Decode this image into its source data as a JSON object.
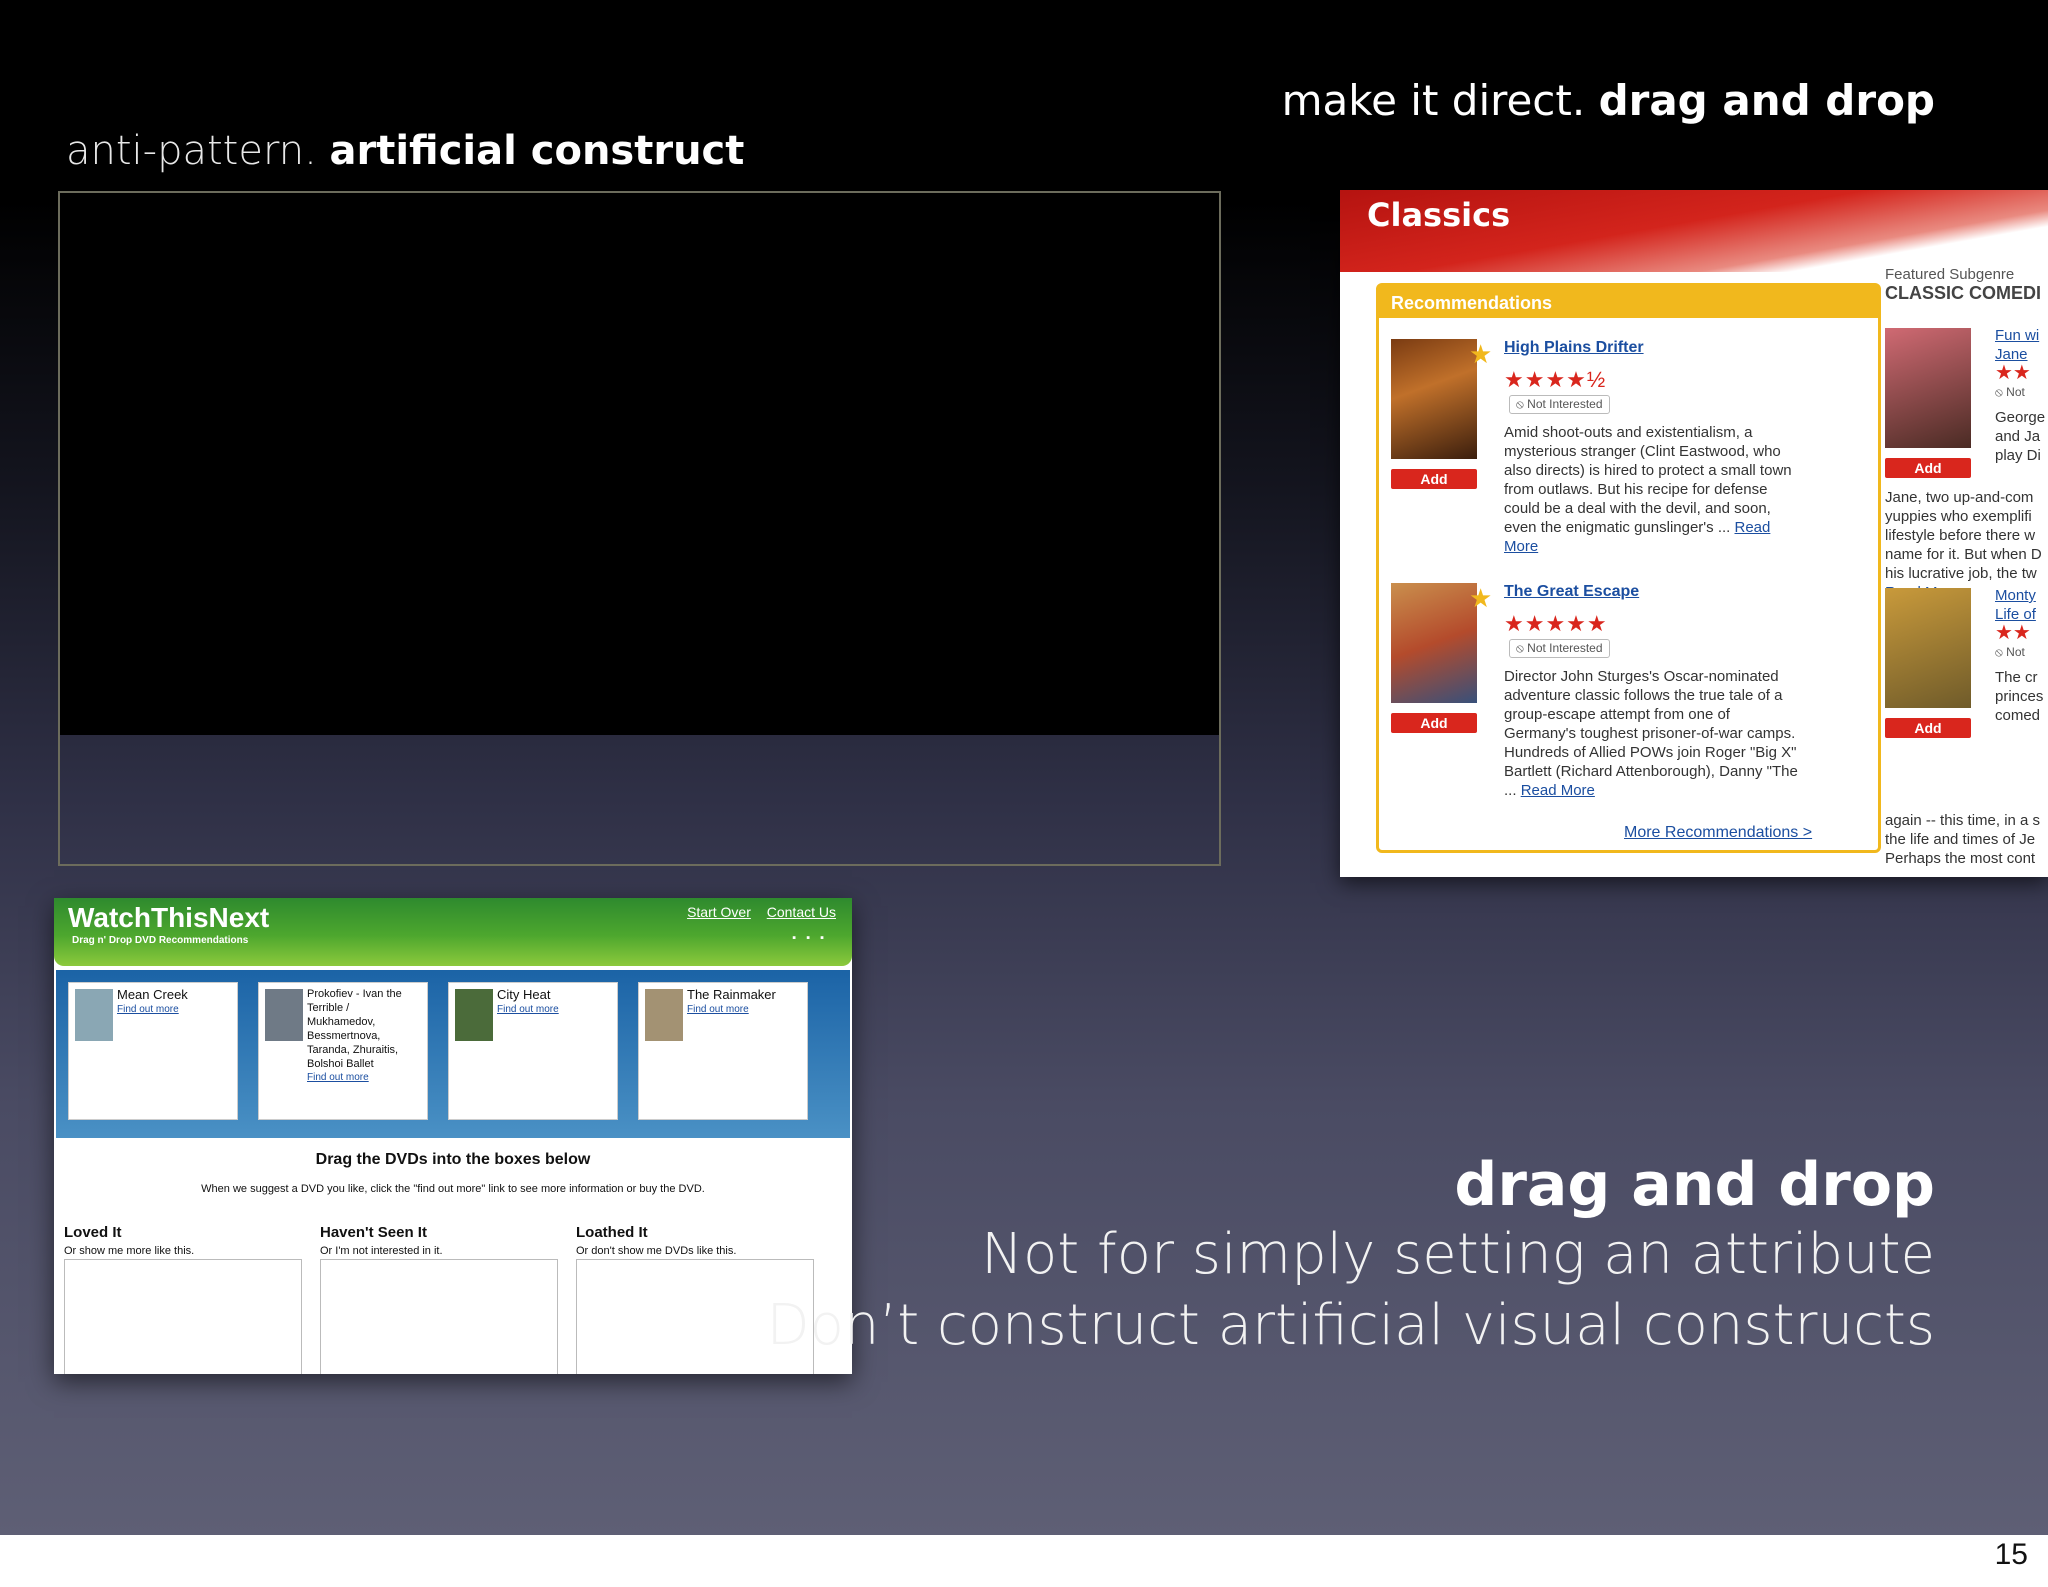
{
  "slide": {
    "title_left_light": "anti-pattern.",
    "title_left_bold": "artificial construct",
    "title_right_light": "make it direct.",
    "title_right_bold": "drag and drop",
    "heading": "drag and drop",
    "line1": "Not for simply setting an attribute",
    "line2": "Don’t construct artificial visual constructs",
    "page_number": "15"
  },
  "classics": {
    "title": "Classics",
    "rec_heading": "Recommendations",
    "items": [
      {
        "title": "High Plains Drifter",
        "rating": "★★★★½",
        "not_interested": "⦸ Not Interested",
        "add": "Add",
        "desc": "Amid shoot-outs and existentialism, a mysterious stranger (Clint Eastwood, who also directs) is hired to protect a small town from outlaws. But his recipe for defense could be a deal with the devil, and soon, even the enigmatic gunslinger's ...",
        "read_more": "Read More"
      },
      {
        "title": "The Great Escape",
        "rating": "★★★★★",
        "not_interested": "⦸ Not Interested",
        "add": "Add",
        "desc": "Director John Sturges's Oscar-nominated adventure classic follows the true tale of a group-escape attempt from one of Germany's toughest prisoner-of-war camps. Hundreds of Allied POWs join Roger \"Big X\" Bartlett (Richard Attenborough), Danny \"The ...",
        "read_more": "Read More"
      }
    ],
    "more_recommendations": "More Recommendations >",
    "featured_label": "Featured Subgenre",
    "featured_subgenre": "CLASSIC COMEDI",
    "featured_items": [
      {
        "title_line1": "Fun wi",
        "title_line2": "Jane",
        "add": "Add",
        "not": "⦸ Not",
        "text": [
          "George",
          "and Ja",
          "play Di",
          "Jane, two up-and-com",
          "yuppies who exemplifi",
          "lifestyle before there w",
          "name for it. But when D",
          "his lucrative job, the tw"
        ],
        "read_more": "Read More"
      },
      {
        "title_line1": "Monty",
        "title_line2": "Life of",
        "add": "Add",
        "not": "⦸ Not",
        "text": [
          "The cr",
          "princes",
          "comed",
          "again -- this time, in a s",
          "the life and times of Je",
          "Perhaps the most cont"
        ]
      }
    ]
  },
  "wtn": {
    "logo": "WatchThisNext",
    "tagline": "Drag n' Drop DVD Recommendations",
    "start_over": "Start Over",
    "contact_us": "Contact Us",
    "dvds": [
      {
        "title": "Mean Creek",
        "link": "Find out more"
      },
      {
        "title": "Prokofiev - Ivan the Terrible / Mukhamedov, Bessmertnova, Taranda, Zhuraitis, Bolshoi Ballet",
        "link": "Find out more"
      },
      {
        "title": "City Heat",
        "link": "Find out more"
      },
      {
        "title": "The Rainmaker",
        "link": "Find out more"
      }
    ],
    "drag_title": "Drag the DVDs into the boxes below",
    "drag_note": "When we suggest a DVD you like, click the \"find out more\" link to see more information or buy the DVD.",
    "bins": [
      {
        "title": "Loved It",
        "sub": "Or show me more like this."
      },
      {
        "title": "Haven't Seen It",
        "sub": "Or I'm not interested in it."
      },
      {
        "title": "Loathed It",
        "sub": "Or don't show me DVDs like this."
      }
    ]
  }
}
